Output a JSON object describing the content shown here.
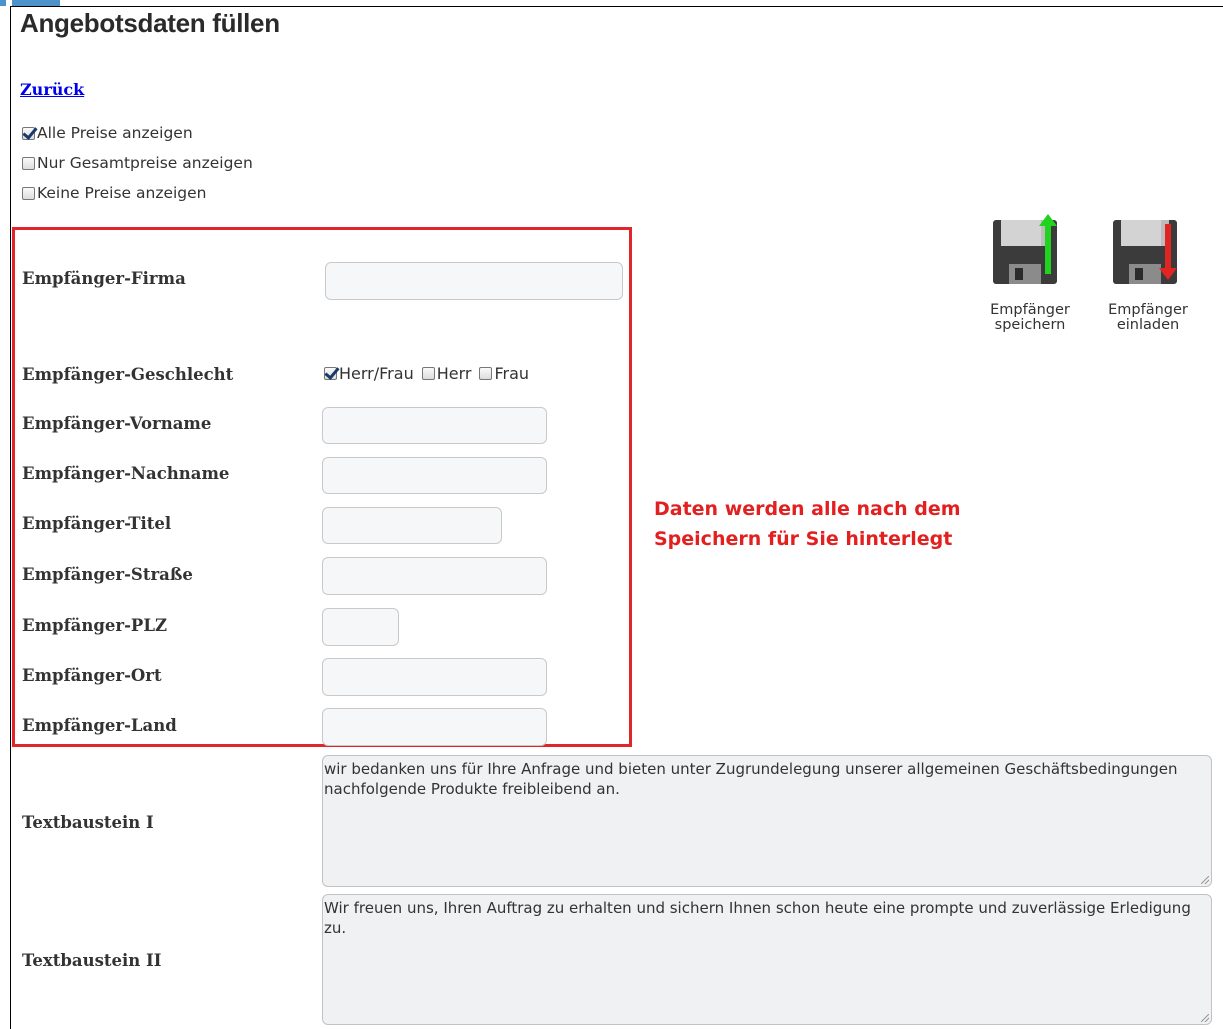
{
  "page": {
    "title": "Angebotsdaten füllen",
    "back_link": "Zurück"
  },
  "price_options": [
    {
      "label": "Alle Preise anzeigen",
      "checked": true
    },
    {
      "label": "Nur Gesamtpreise anzeigen",
      "checked": false
    },
    {
      "label": "Keine Preise anzeigen",
      "checked": false
    }
  ],
  "recipient": {
    "firma_label": "Empfänger-Firma",
    "geschlecht_label": "Empfänger-Geschlecht",
    "gender_options": [
      {
        "label": "Herr/Frau",
        "checked": true
      },
      {
        "label": "Herr",
        "checked": false
      },
      {
        "label": "Frau",
        "checked": false
      }
    ],
    "vorname_label": "Empfänger-Vorname",
    "nachname_label": "Empfänger-Nachname",
    "titel_label": "Empfänger-Titel",
    "strasse_label": "Empfänger-Straße",
    "plz_label": "Empfänger-PLZ",
    "ort_label": "Empfänger-Ort",
    "land_label": "Empfänger-Land"
  },
  "annotation": {
    "note": "Daten werden alle nach dem\nSpeichern für Sie hinterlegt",
    "color": "#e32020"
  },
  "actions": {
    "save": {
      "line1": "Empfänger",
      "line2": "speichern"
    },
    "load": {
      "line1": "Empfänger",
      "line2": "einladen"
    }
  },
  "texts": {
    "text1_label": "Textbaustein I",
    "text1_value": "wir bedanken uns für Ihre Anfrage und bieten unter Zugrundelegung unserer allgemeinen Geschäftsbedingungen nachfolgende Produkte freibleibend an.",
    "text2_label": "Textbaustein II",
    "text2_value": "Wir freuen uns, Ihren Auftrag zu erhalten und sichern Ihnen schon heute eine prompte und zuverlässige Erledigung zu."
  }
}
